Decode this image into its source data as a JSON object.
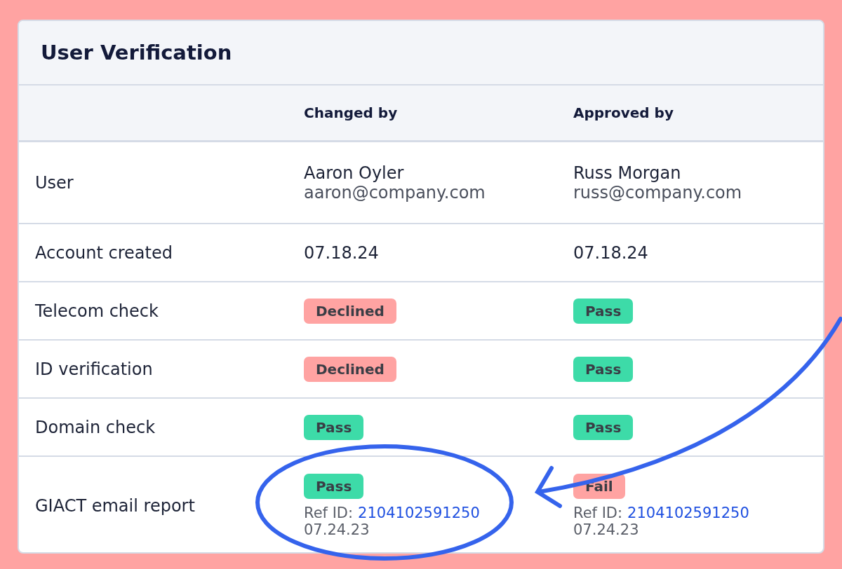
{
  "card": {
    "title": "User Verification"
  },
  "table": {
    "columns": [
      "Changed by",
      "Approved by"
    ],
    "rows": [
      {
        "label": "User",
        "cells": [
          {
            "kind": "person",
            "name": "Aaron Oyler",
            "email": "aaron@company.com"
          },
          {
            "kind": "person",
            "name": "Russ Morgan",
            "email": "russ@company.com"
          }
        ]
      },
      {
        "label": "Account created",
        "cells": [
          {
            "kind": "text",
            "text": "07.18.24"
          },
          {
            "kind": "text",
            "text": "07.18.24"
          }
        ]
      },
      {
        "label": "Telecom check",
        "cells": [
          {
            "kind": "status",
            "status": "Declined",
            "color": "#ffa3a2"
          },
          {
            "kind": "status",
            "status": "Pass",
            "color": "#3ddba8"
          }
        ]
      },
      {
        "label": "ID verification",
        "cells": [
          {
            "kind": "status",
            "status": "Declined",
            "color": "#ffa3a2"
          },
          {
            "kind": "status",
            "status": "Pass",
            "color": "#3ddba8"
          }
        ]
      },
      {
        "label": "Domain check",
        "cells": [
          {
            "kind": "status",
            "status": "Pass",
            "color": "#3ddba8"
          },
          {
            "kind": "status",
            "status": "Pass",
            "color": "#3ddba8"
          }
        ]
      },
      {
        "label": "GIACT email report",
        "cells": [
          {
            "kind": "report",
            "status": "Pass",
            "color": "#3ddba8",
            "ref_label": "Ref ID:",
            "ref_id": "2104102591250",
            "date": "07.24.23"
          },
          {
            "kind": "report",
            "status": "Fail",
            "color": "#ffa3a2",
            "ref_label": "Ref ID:",
            "ref_id": "2104102591250",
            "date": "07.24.23"
          }
        ]
      }
    ]
  }
}
